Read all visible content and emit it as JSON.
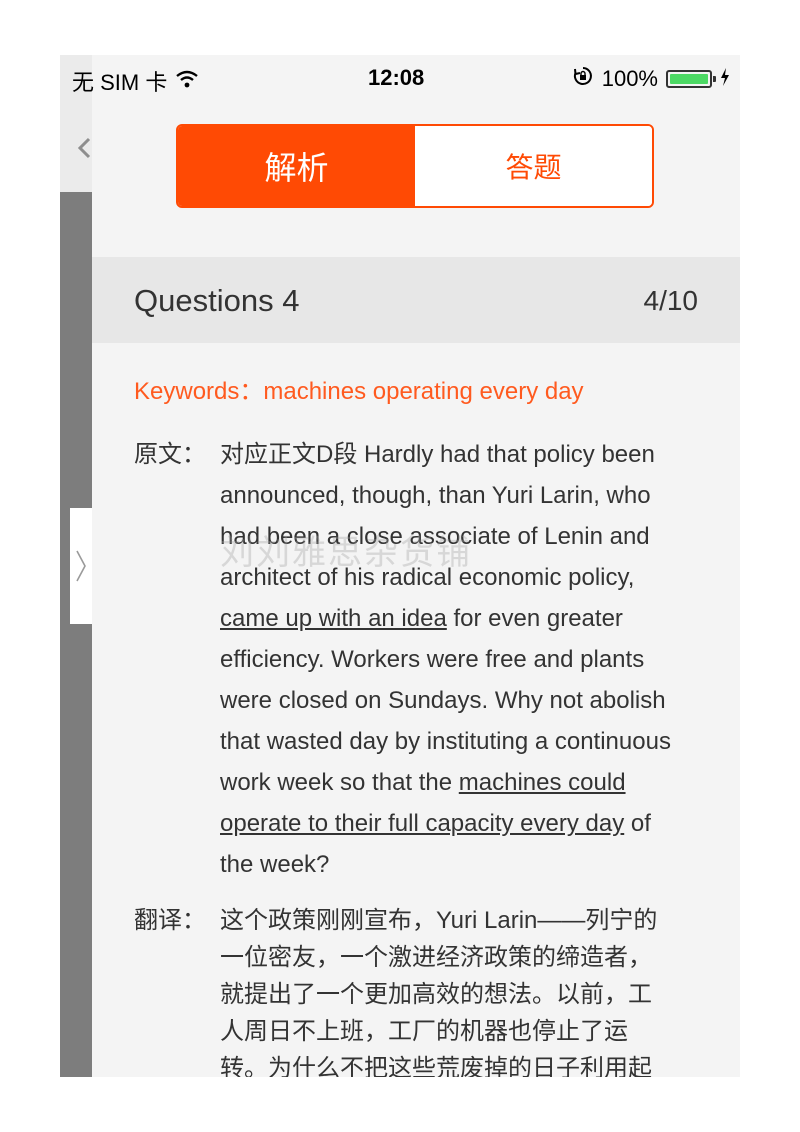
{
  "status_bar": {
    "carrier": "无 SIM 卡",
    "time": "12:08",
    "battery_percent": "100%",
    "battery_level": 1.0,
    "icons": [
      "wifi-icon",
      "orientation-lock-icon",
      "battery-icon",
      "charging-icon"
    ]
  },
  "segmented": {
    "active_label": "解析",
    "inactive_label": "答题"
  },
  "question": {
    "title": "Questions 4",
    "counter": "4/10"
  },
  "keywords": "Keywords：machines operating every day",
  "original": {
    "label": "原文：",
    "lines": [
      {
        "parts": [
          {
            "text": "对应正文D段 Hardly had that policy been",
            "u": false
          }
        ]
      },
      {
        "parts": [
          {
            "text": "announced, though, than Yuri Larin, who",
            "u": false
          }
        ]
      },
      {
        "parts": [
          {
            "text": "had been a close associate of Lenin and",
            "u": false
          }
        ]
      },
      {
        "parts": [
          {
            "text": "architect of his radical economic policy,",
            "u": false
          }
        ]
      },
      {
        "parts": [
          {
            "text": "came up with an idea",
            "u": true
          },
          {
            "text": " for even greater",
            "u": false
          }
        ]
      },
      {
        "parts": [
          {
            "text": "efficiency. Workers were free and plants",
            "u": false
          }
        ]
      },
      {
        "parts": [
          {
            "text": "were closed on Sundays. Why not abolish",
            "u": false
          }
        ]
      },
      {
        "parts": [
          {
            "text": "that wasted day by instituting a continuous",
            "u": false
          }
        ]
      },
      {
        "parts": [
          {
            "text": "work week so that the ",
            "u": false
          },
          {
            "text": "machines could",
            "u": true
          }
        ]
      },
      {
        "parts": [
          {
            "text": "operate to their full capacity every day",
            "u": true
          },
          {
            "text": " of",
            "u": false
          }
        ]
      },
      {
        "parts": [
          {
            "text": "the week?",
            "u": false
          }
        ]
      }
    ]
  },
  "translation": {
    "label": "翻译：",
    "lines": [
      "这个政策刚刚宣布，Yuri Larin——列宁的",
      "一位密友，一个激进经济政策的缔造者，",
      "就提出了一个更加高效的想法。以前，工",
      "人周日不上班，工厂的机器也停止了运",
      "转。为什么不把这些荒废掉的日子利用起"
    ]
  },
  "watermark": "刘刘雅思杂货铺",
  "colors": {
    "accent": "#ff4a04",
    "keyword": "#ff5a1f",
    "header_bg": "#e7e7e7",
    "page_bg": "#f4f4f4"
  }
}
